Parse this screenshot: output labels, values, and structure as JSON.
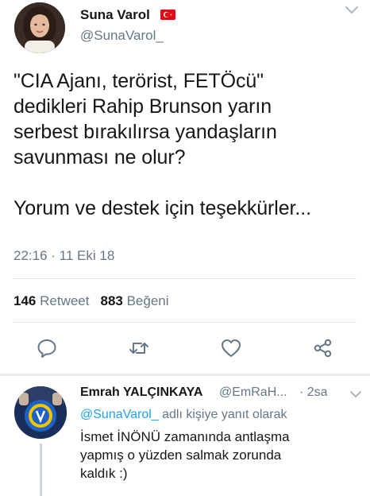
{
  "tweet": {
    "author_name": "Suna Varol",
    "author_handle": "@SunaVarol_",
    "flag_icon": "turkey-flag-icon",
    "text": "\"CIA Ajanı, terörist, FETÖcü\"\ndedikleri Rahip Brunson yarın\nserbest bırakılırsa yandaşların\nsavunması ne olur?\n\nYorum ve destek için teşekkürler...",
    "timestamp": "22:16 · 11 Eki 18",
    "retweet_count": "146",
    "retweet_label": "Retweet",
    "like_count": "883",
    "like_label": "Beğeni"
  },
  "reply": {
    "author_name": "Emrah YALÇINKAYA",
    "author_handle": "@EmRaH...",
    "time": "· 2sa",
    "context_mention": "@SunaVarol_",
    "context_suffix": " adlı kişiye yanıt olarak",
    "text": "İsmet İNÖNÜ zamanında antlaşma\nyapmış o yüzden salmak zorunda\nkaldık :)"
  },
  "colors": {
    "accent": "#1da1f2",
    "secondary_text": "#657786",
    "divider": "#e1e8ed",
    "flag_red": "#e30a17"
  },
  "icons": [
    "reply-icon",
    "retweet-icon",
    "like-icon",
    "share-icon",
    "chevron-down-icon"
  ]
}
